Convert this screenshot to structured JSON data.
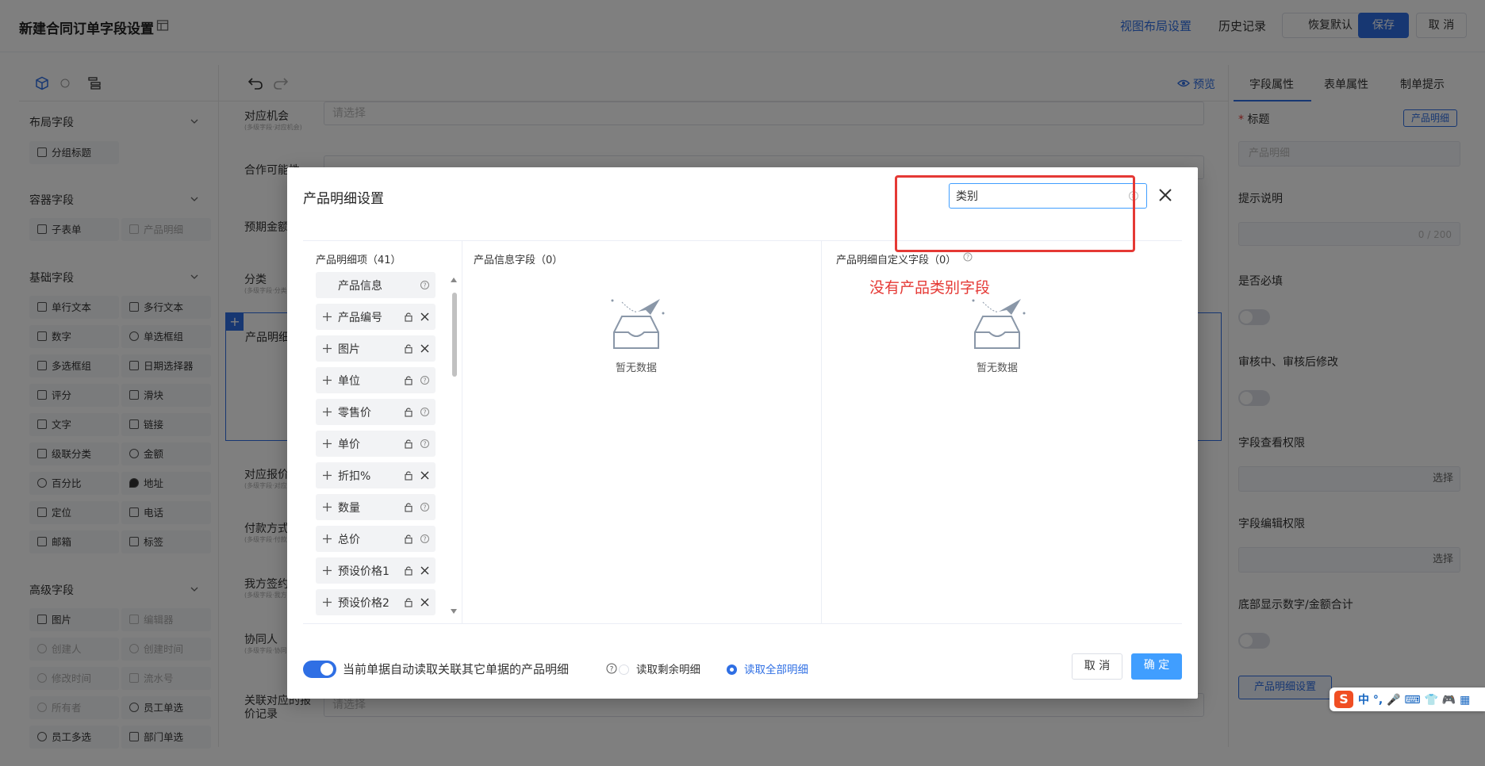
{
  "header": {
    "title": "新建合同订单字段设置",
    "view_layout": "视图布局设置",
    "history": "历史记录",
    "restore": "恢复默认",
    "save": "保存",
    "cancel": "取 消"
  },
  "left_panel": {
    "groups": [
      {
        "title": "布局字段",
        "items": [
          "分组标题"
        ]
      },
      {
        "title": "容器字段",
        "items": [
          "子表单",
          "产品明细"
        ]
      },
      {
        "title": "基础字段",
        "items": [
          "单行文本",
          "多行文本",
          "数字",
          "单选框组",
          "多选框组",
          "日期选择器",
          "评分",
          "滑块",
          "文字",
          "链接",
          "级联分类",
          "金额",
          "百分比",
          "地址",
          "定位",
          "电话",
          "邮箱",
          "标签"
        ]
      },
      {
        "title": "高级字段",
        "items": [
          "图片",
          "编辑器",
          "创建人",
          "创建时间",
          "修改时间",
          "流水号",
          "所有者",
          "员工单选",
          "员工多选",
          "部门单选"
        ]
      }
    ]
  },
  "canvas": {
    "preview": "预览",
    "rows": [
      {
        "label": "对应机会",
        "sub": "(多级字段·对应机会)",
        "placeholder": "请选择"
      },
      {
        "label": "合作可能性",
        "sub": "",
        "placeholder": ""
      },
      {
        "label": "预期金额",
        "sub": "",
        "placeholder": ""
      },
      {
        "label": "分类",
        "sub": "(多级字段·分类)",
        "placeholder": ""
      },
      {
        "label": "产品明细",
        "sub": "",
        "placeholder": ""
      },
      {
        "label": "对应报价",
        "sub": "(多级字段·对应报价)",
        "placeholder": ""
      },
      {
        "label": "付款方式",
        "sub": "(多级字段·付款方式)",
        "placeholder": ""
      },
      {
        "label": "我方签约人",
        "sub": "(多级字段·我方签约人)",
        "placeholder": ""
      },
      {
        "label": "协同人",
        "sub": "(多级字段·协同人)",
        "placeholder": ""
      },
      {
        "label": "关联对应的报价记录",
        "sub": "",
        "placeholder": "请选择"
      }
    ]
  },
  "right_panel": {
    "tabs": [
      "字段属性",
      "表单属性",
      "制单提示"
    ],
    "title_label": "标题",
    "title_tag": "产品明细",
    "title_value": "产品明细",
    "hint_label": "提示说明",
    "hint_count": "0 / 200",
    "required_label": "是否必填",
    "audit_label": "审核中、审核后修改",
    "view_perm_label": "字段查看权限",
    "edit_perm_label": "字段编辑权限",
    "select": "选择",
    "sum_label": "底部显示数字/金额合计",
    "detail_btn": "产品明细设置"
  },
  "dialog": {
    "title": "产品明细设置",
    "search_value": "类别",
    "col1_title": "产品明细项（41）",
    "col2_title": "产品信息字段（0）",
    "col3_title": "产品明细自定义字段（0）",
    "items": [
      "产品信息",
      "产品编号",
      "图片",
      "单位",
      "零售价",
      "单价",
      "折扣%",
      "数量",
      "总价",
      "预设价格1",
      "预设价格2"
    ],
    "empty_text": "暂无数据",
    "auto_read_label": "当前单据自动读取关联其它单据的产品明细",
    "read_remaining": "读取剩余明细",
    "read_all": "读取全部明细",
    "cancel": "取 消",
    "confirm": "确 定"
  },
  "annotation": {
    "text": "没有产品类别字段"
  },
  "ime": {
    "text": "中 °, 🎤 ⌨ 👕 🎮 ▦"
  },
  "colors": {
    "primary": "#2f6fe4",
    "annotation": "#e53935",
    "input_focus": "#409eff"
  }
}
